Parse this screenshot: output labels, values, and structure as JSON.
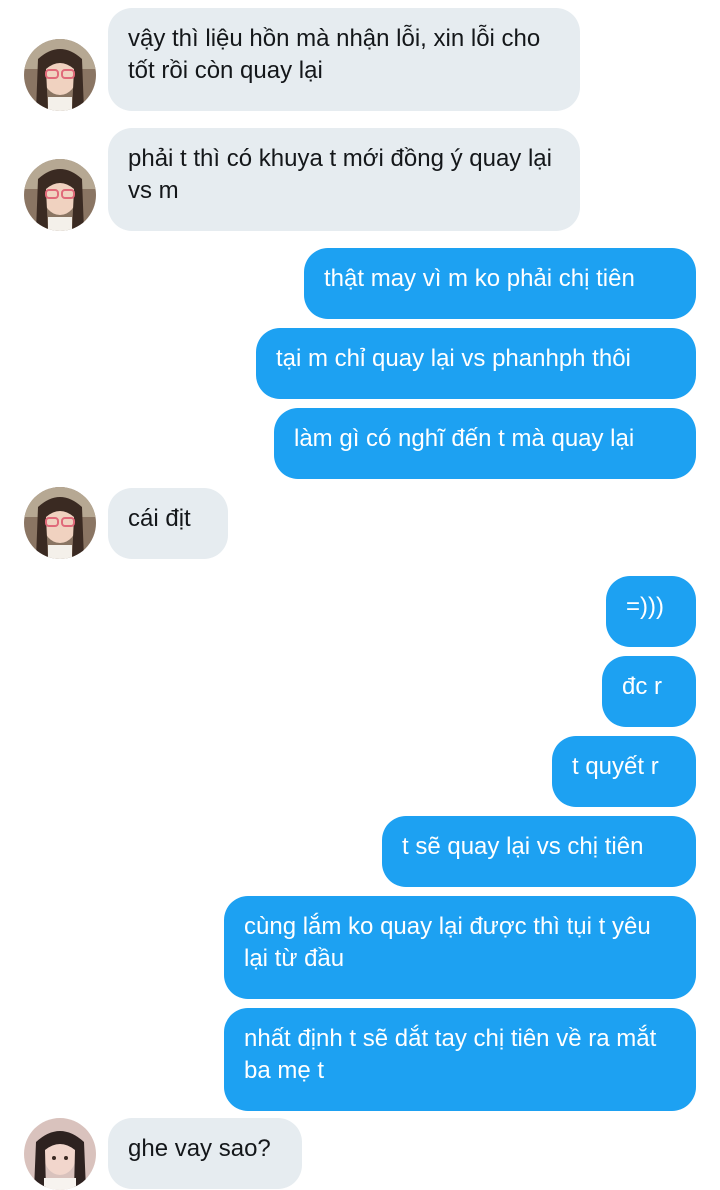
{
  "conversation": {
    "colors": {
      "incoming_bubble": "#e6ecf0",
      "outgoing_bubble": "#1da1f2",
      "incoming_text": "#14171a",
      "outgoing_text": "#ffffff"
    },
    "messages": [
      {
        "side": "in",
        "text": "vậy thì liệu hồn mà nhận lỗi, xin lỗi cho tốt rồi còn quay lại",
        "avatar": "sender-avatar-1"
      },
      {
        "side": "in",
        "text": "phải t thì có khuya t mới đồng ý quay lại vs m",
        "avatar": "sender-avatar-1"
      },
      {
        "side": "out",
        "text": "thật may vì m ko phải chị tiên"
      },
      {
        "side": "out",
        "text": "tại m chỉ quay lại vs phanhph thôi"
      },
      {
        "side": "out",
        "text": "làm gì có nghĩ đến t mà quay lại"
      },
      {
        "side": "in",
        "text": "cái địt",
        "avatar": "sender-avatar-1"
      },
      {
        "side": "out",
        "text": "=)))"
      },
      {
        "side": "out",
        "text": "đc r"
      },
      {
        "side": "out",
        "text": "t quyết r"
      },
      {
        "side": "out",
        "text": "t sẽ quay lại vs chị tiên"
      },
      {
        "side": "out",
        "text": "cùng lắm ko quay lại được thì tụi t yêu lại từ đầu"
      },
      {
        "side": "out",
        "text": "nhất định t sẽ dắt tay chị tiên về ra mắt ba mẹ t"
      },
      {
        "side": "in",
        "text": "ghe vay sao?",
        "avatar": "sender-avatar-2"
      }
    ]
  }
}
